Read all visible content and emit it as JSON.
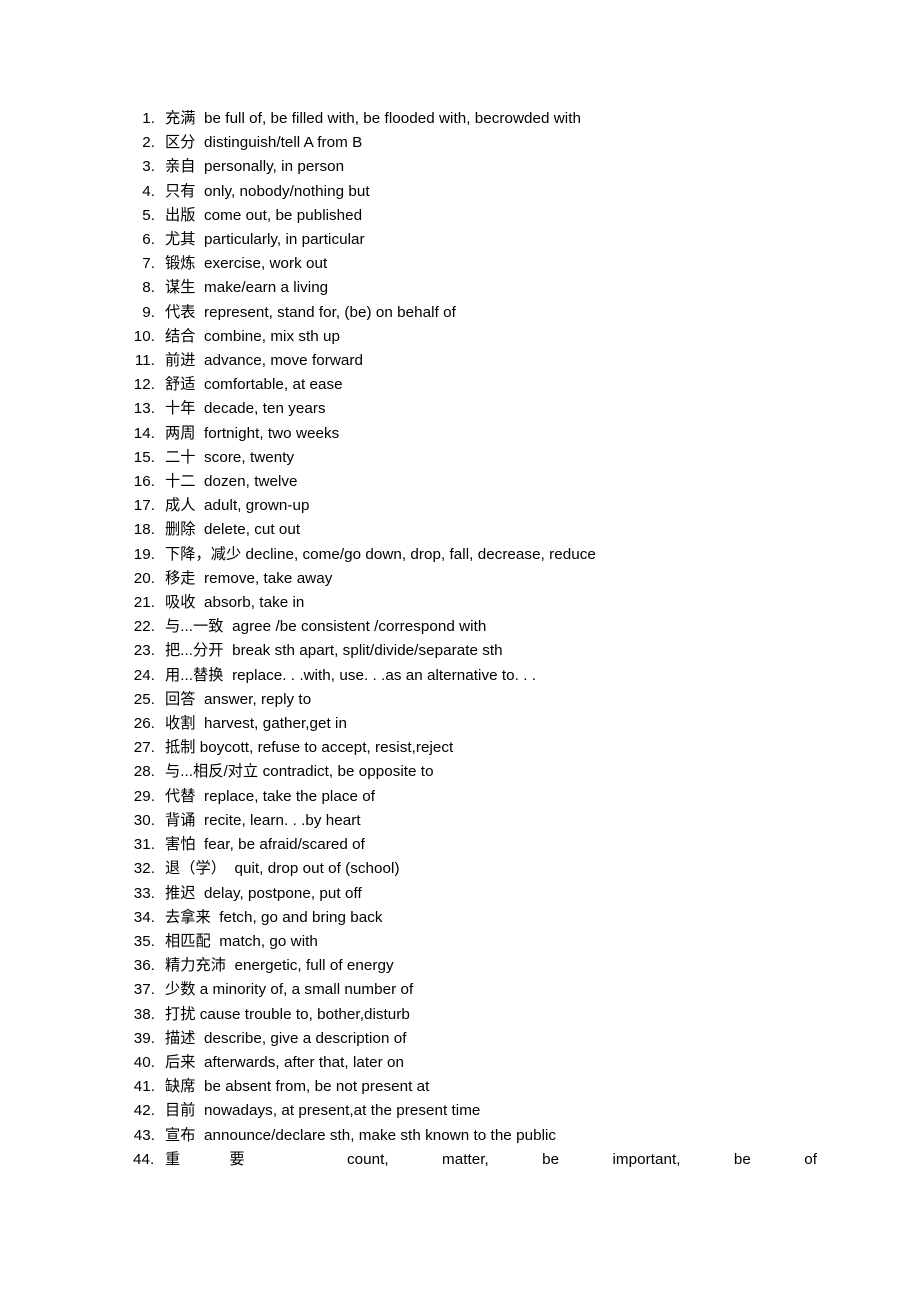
{
  "document": {
    "type": "vocabulary-list",
    "items": [
      {
        "number": "1.",
        "term": "充满",
        "gloss": "be full of, be filled with, be flooded with, becrowded with"
      },
      {
        "number": "2.",
        "term": "区分",
        "gloss": "distinguish/tell A from B"
      },
      {
        "number": "3.",
        "term": "亲自",
        "gloss": "personally, in person"
      },
      {
        "number": "4.",
        "term": "只有",
        "gloss": "only, nobody/nothing but"
      },
      {
        "number": "5.",
        "term": "出版",
        "gloss": "come out, be published"
      },
      {
        "number": "6.",
        "term": "尤其",
        "gloss": "particularly, in particular"
      },
      {
        "number": "7.",
        "term": "锻炼",
        "gloss": "exercise, work out"
      },
      {
        "number": "8.",
        "term": "谋生",
        "gloss": "make/earn a living"
      },
      {
        "number": "9.",
        "term": "代表",
        "gloss": "represent, stand for, (be) on behalf of"
      },
      {
        "number": "10.",
        "term": "结合",
        "gloss": "combine, mix sth up"
      },
      {
        "number": "11.",
        "term": "前进",
        "gloss": "advance, move forward"
      },
      {
        "number": "12.",
        "term": "舒适",
        "gloss": "comfortable, at ease"
      },
      {
        "number": "13.",
        "term": "十年",
        "gloss": "decade, ten years"
      },
      {
        "number": "14.",
        "term": "两周",
        "gloss": "fortnight, two weeks"
      },
      {
        "number": "15.",
        "term": "二十",
        "gloss": "score, twenty"
      },
      {
        "number": "16.",
        "term": "十二",
        "gloss": "dozen, twelve"
      },
      {
        "number": "17.",
        "term": "成人",
        "gloss": "adult, grown-up"
      },
      {
        "number": "18.",
        "term": "删除",
        "gloss": "delete, cut out"
      },
      {
        "number": "19.",
        "term": "下降，减少",
        "gloss": "decline, come/go down, drop, fall, decrease, reduce"
      },
      {
        "number": "20.",
        "term": "移走",
        "gloss": "remove, take away"
      },
      {
        "number": "21.",
        "term": "吸收",
        "gloss": "absorb, take in"
      },
      {
        "number": "22.",
        "term": "与...一致",
        "gloss": "agree /be consistent /correspond with"
      },
      {
        "number": "23.",
        "term": "把...分开",
        "gloss": "break sth apart, split/divide/separate sth"
      },
      {
        "number": "24.",
        "term": "用...替换",
        "gloss": "replace. . .with, use. . .as an alternative to. . ."
      },
      {
        "number": "25.",
        "term": "回答",
        "gloss": "answer, reply to"
      },
      {
        "number": "26.",
        "term": "收割",
        "gloss": "harvest, gather,get in"
      },
      {
        "number": "27.",
        "term": "抵制",
        "gloss": "boycott, refuse to accept, resist,reject"
      },
      {
        "number": "28.",
        "term": "与...相反/对立",
        "gloss": "contradict, be opposite to"
      },
      {
        "number": "29.",
        "term": "代替",
        "gloss": "replace, take the place of"
      },
      {
        "number": "30.",
        "term": "背诵",
        "gloss": "recite, learn. . .by heart"
      },
      {
        "number": "31.",
        "term": "害怕",
        "gloss": "fear, be afraid/scared of"
      },
      {
        "number": "32.",
        "term": "退（学）",
        "gloss": "quit, drop out of (school)"
      },
      {
        "number": "33.",
        "term": "推迟",
        "gloss": "delay, postpone, put off"
      },
      {
        "number": "34.",
        "term": "去拿来",
        "gloss": "fetch, go and bring back"
      },
      {
        "number": "35.",
        "term": "相匹配",
        "gloss": "match, go with"
      },
      {
        "number": "36.",
        "term": "精力充沛",
        "gloss": "energetic, full of energy"
      },
      {
        "number": "37.",
        "term": "少数",
        "gloss": "a minority of, a small number of"
      },
      {
        "number": "38.",
        "term": "打扰",
        "gloss": "cause trouble to, bother,disturb"
      },
      {
        "number": "39.",
        "term": "描述",
        "gloss": "describe, give a description of"
      },
      {
        "number": "40.",
        "term": "后来",
        "gloss": "afterwards, after that, later on"
      },
      {
        "number": "41.",
        "term": "缺席",
        "gloss": "be absent from, be not present at"
      },
      {
        "number": "42.",
        "term": "目前",
        "gloss": "nowadays, at present,at the present time"
      },
      {
        "number": "43.",
        "term": "宣布",
        "gloss": "announce/declare sth, make sth known to the public"
      },
      {
        "number": "44.",
        "term": "重要",
        "gloss": "count, matter, be important, be of"
      }
    ]
  }
}
